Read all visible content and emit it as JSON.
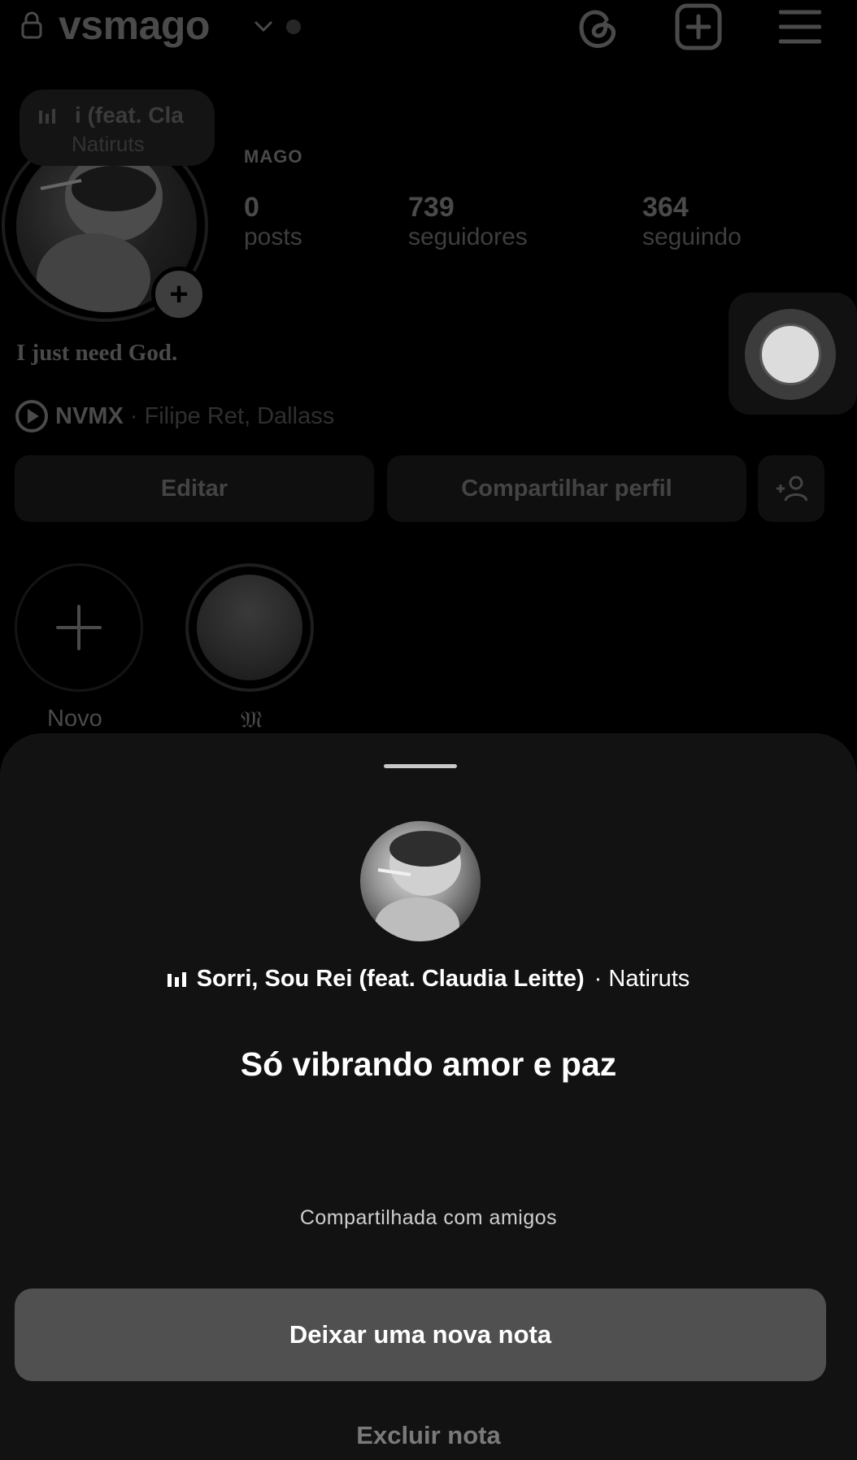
{
  "header": {
    "username": "vsmago"
  },
  "note_preview": {
    "title": "i (feat. Cla",
    "artist": "Natiruts"
  },
  "profile": {
    "display_name": "MAGO",
    "stats": [
      {
        "value": "0",
        "label": "posts"
      },
      {
        "value": "739",
        "label": "seguidores"
      },
      {
        "value": "364",
        "label": "seguindo"
      }
    ],
    "bio": "I just need God.",
    "music": {
      "name": "NVMX",
      "artist": "· Filipe Ret, Dallass"
    },
    "buttons": {
      "edit": "Editar",
      "share": "Compartilhar perfil"
    },
    "highlights": [
      {
        "label": "Novo"
      },
      {
        "label": "𝔐"
      }
    ]
  },
  "sheet": {
    "song_title": "Sorri, Sou Rei (feat. Claudia Leitte)",
    "song_artist": "· Natiruts",
    "note_text": "Só vibrando amor e paz",
    "shared_with": "Compartilhada com amigos",
    "primary_button": "Deixar uma nova nota",
    "secondary_button": "Excluir nota"
  },
  "icons": {
    "lock": "lock-icon",
    "chevron": "chevron-down-icon",
    "threads": "threads-icon",
    "create": "plus-square-icon",
    "menu": "hamburger-menu-icon",
    "music_bars": "equalizer-icon",
    "play": "play-circle-icon",
    "add_user": "add-user-icon"
  },
  "colors": {
    "sheet_bg": "#121212",
    "primary_button_bg": "#505050",
    "dimmed_text": "#4a4a4a"
  }
}
